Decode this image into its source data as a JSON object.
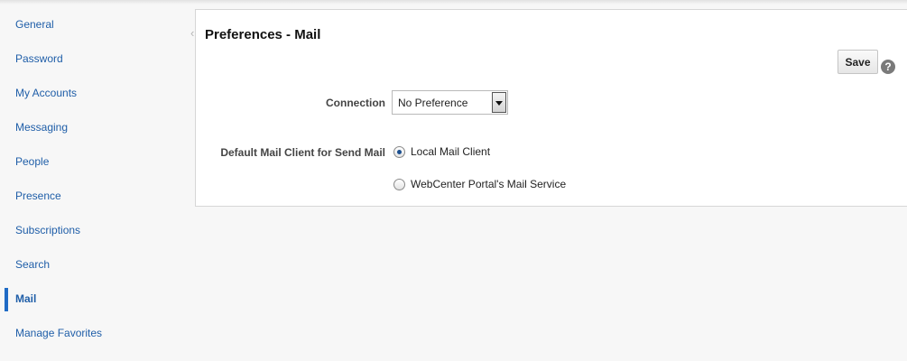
{
  "sidebar": {
    "items": [
      {
        "label": "General"
      },
      {
        "label": "Password"
      },
      {
        "label": "My Accounts"
      },
      {
        "label": "Messaging"
      },
      {
        "label": "People"
      },
      {
        "label": "Presence"
      },
      {
        "label": "Subscriptions"
      },
      {
        "label": "Search"
      },
      {
        "label": "Mail",
        "active": true
      },
      {
        "label": "Manage Favorites"
      }
    ],
    "collapse_icon": "chevron-left-icon"
  },
  "panel": {
    "title": "Preferences - Mail",
    "save_label": "Save",
    "help_glyph": "?",
    "connection": {
      "label": "Connection",
      "selected": "No Preference"
    },
    "mail_client": {
      "label": "Default Mail Client for Send Mail",
      "options": [
        {
          "label": "Local Mail Client",
          "checked": true
        },
        {
          "label": "WebCenter Portal's Mail Service",
          "checked": false
        }
      ]
    }
  },
  "colors": {
    "link": "#1f5ea8",
    "active_bar": "#1f6bc5",
    "background": "#f7f7f7"
  }
}
